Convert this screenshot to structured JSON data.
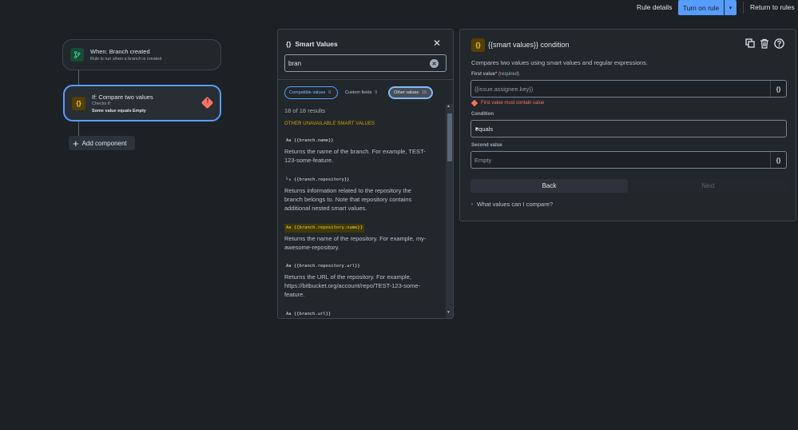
{
  "header": {
    "rule_details": "Rule details",
    "turn_on": "Turn on rule",
    "return": "Return to rules"
  },
  "flow": {
    "trigger": {
      "title": "When: Branch created",
      "subtitle": "Rule is run when a branch is created"
    },
    "condition": {
      "title": "If: Compare two values",
      "checks": "Checks if:",
      "summary": "Some value equals Empty"
    },
    "add_component": "Add component"
  },
  "smart_values": {
    "title": "Smart Values",
    "search_value": "bran",
    "tabs": [
      {
        "label": "Compatible values",
        "count": "0"
      },
      {
        "label": "Custom fields",
        "count": "0"
      },
      {
        "label": "Other values",
        "count": "18"
      }
    ],
    "results_count": "18 of 18 results",
    "section_heading": "OTHER UNAVAILABLE SMART VALUES",
    "items": [
      {
        "icon": "Aa",
        "code": "{{branch.name}}",
        "desc": "Returns the name of the branch. For example, TEST-123-some-feature."
      },
      {
        "icon": "⅟₀",
        "code": "{{branch.repository}}",
        "desc": "Returns information related to the repository the branch belongs to. Note that repository contains additional nested smart values."
      },
      {
        "icon": "Aa",
        "code": "{{branch.repository.name}}",
        "desc": "Returns the name of the repository. For example, my-awesome-repository."
      },
      {
        "icon": "Aa",
        "code": "{{branch.repository.url}}",
        "desc": "Returns the URL of the repository. For example, https://bitbucket.org/account/repo/TEST-123-some-feature."
      },
      {
        "icon": "Aa",
        "code": "{{branch.url}}",
        "desc": ""
      }
    ]
  },
  "config": {
    "title": "{{smart values}} condition",
    "description": "Compares two values using smart values and regular expressions.",
    "first_label": "First value",
    "first_required": "(required)",
    "first_placeholder": "{{issue.assignee.key}}",
    "first_error": "First value must contain value",
    "condition_label": "Condition",
    "condition_value": "equals",
    "second_label": "Second value",
    "second_placeholder": "Empty",
    "sv_button": "{}",
    "back": "Back",
    "next": "Next",
    "compare_link": "What values can I compare?"
  },
  "colors": {
    "accent": "#579dff",
    "error": "#f87168",
    "warning": "#f5cd47",
    "background": "#1d2125"
  },
  "icons": [
    "branch-icon",
    "braces-icon",
    "error-icon",
    "plus-icon",
    "close-icon",
    "clear-icon",
    "copy-icon",
    "trash-icon",
    "help-icon",
    "chevron-down-icon",
    "chevron-right-icon"
  ]
}
